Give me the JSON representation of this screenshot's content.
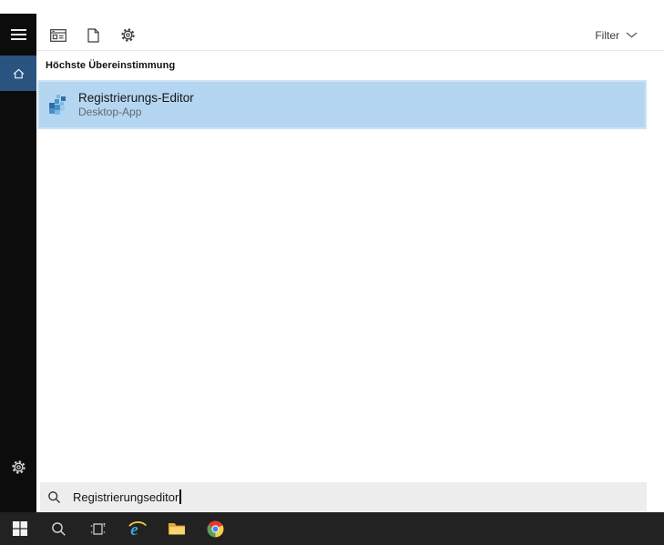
{
  "colors": {
    "rail_background": "#0c0c0c",
    "accent_blue": "#2a5380",
    "result_highlight_blue": "#b5d6f1",
    "search_box_gray": "#ededed",
    "taskbar_dark": "#222222",
    "divider_gray": "#e6e6e6"
  },
  "start_menu": {
    "rail": {
      "icons": [
        "hamburger-menu-icon",
        "home-icon",
        "settings-gear-icon"
      ]
    },
    "filter_bar": {
      "icons": [
        "apps-window-icon",
        "document-icon",
        "settings-gear-icon"
      ],
      "filter_label": "Filter",
      "chevron": "chevron-down-icon"
    },
    "results": {
      "section_header": "Höchste Übereinstimmung",
      "items": [
        {
          "icon": "registry-editor-icon",
          "title": "Registrierungs-Editor",
          "subtitle": "Desktop-App",
          "selected": true
        }
      ]
    },
    "search_box": {
      "icon": "search-icon",
      "value": "Registrierungseditor"
    }
  },
  "taskbar": {
    "buttons": [
      {
        "icon": "windows-start-icon"
      },
      {
        "icon": "search-icon"
      },
      {
        "icon": "task-view-icon"
      },
      {
        "icon": "internet-explorer-icon"
      },
      {
        "icon": "file-explorer-icon"
      },
      {
        "icon": "chrome-icon"
      }
    ]
  }
}
